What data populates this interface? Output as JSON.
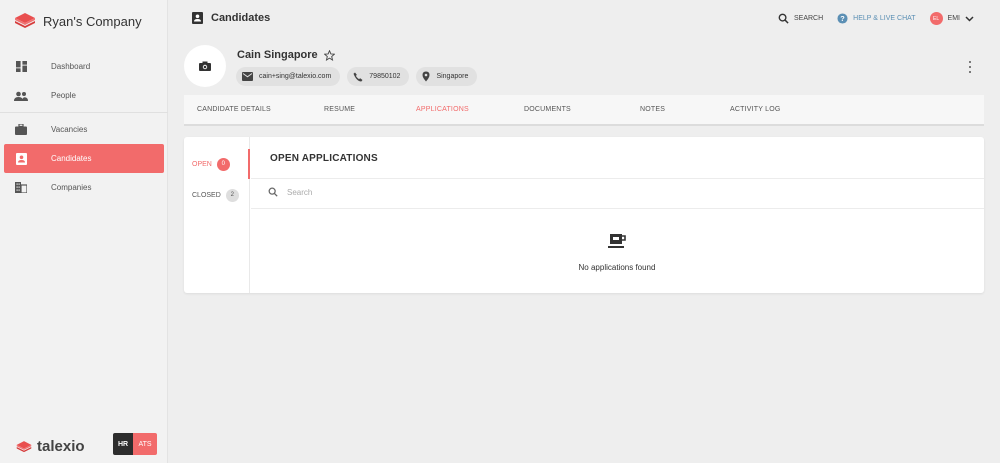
{
  "company": {
    "name": "Ryan's Company"
  },
  "sidebar": {
    "items": [
      {
        "label": "Dashboard",
        "icon": "dashboard-icon"
      },
      {
        "label": "People",
        "icon": "people-icon"
      },
      {
        "label": "Vacancies",
        "icon": "briefcase-icon"
      },
      {
        "label": "Candidates",
        "icon": "candidate-card-icon",
        "active": true
      },
      {
        "label": "Companies",
        "icon": "building-icon"
      }
    ]
  },
  "footer": {
    "brand": "talexio",
    "badge_hr": "HR",
    "badge_ats": "ATS"
  },
  "header": {
    "title": "Candidates",
    "search_label": "SEARCH",
    "help_label": "HELP & LIVE CHAT",
    "avatar_initials": "EL",
    "user_label": "EMI"
  },
  "candidate": {
    "name": "Cain Singapore",
    "email": "cain+sing@talexio.com",
    "phone": "79850102",
    "location": "Singapore"
  },
  "tabs": [
    {
      "label": "CANDIDATE DETAILS"
    },
    {
      "label": "RESUME"
    },
    {
      "label": "APPLICATIONS",
      "active": true
    },
    {
      "label": "DOCUMENTS"
    },
    {
      "label": "NOTES"
    },
    {
      "label": "ACTIVITY LOG"
    }
  ],
  "applications": {
    "filters": [
      {
        "label": "OPEN",
        "count": "0",
        "active": true
      },
      {
        "label": "CLOSED",
        "count": "2"
      }
    ],
    "title": "OPEN APPLICATIONS",
    "search_placeholder": "Search",
    "empty_text": "No applications found"
  },
  "colors": {
    "accent": "#f26b6b",
    "help": "#5b8fb4"
  }
}
